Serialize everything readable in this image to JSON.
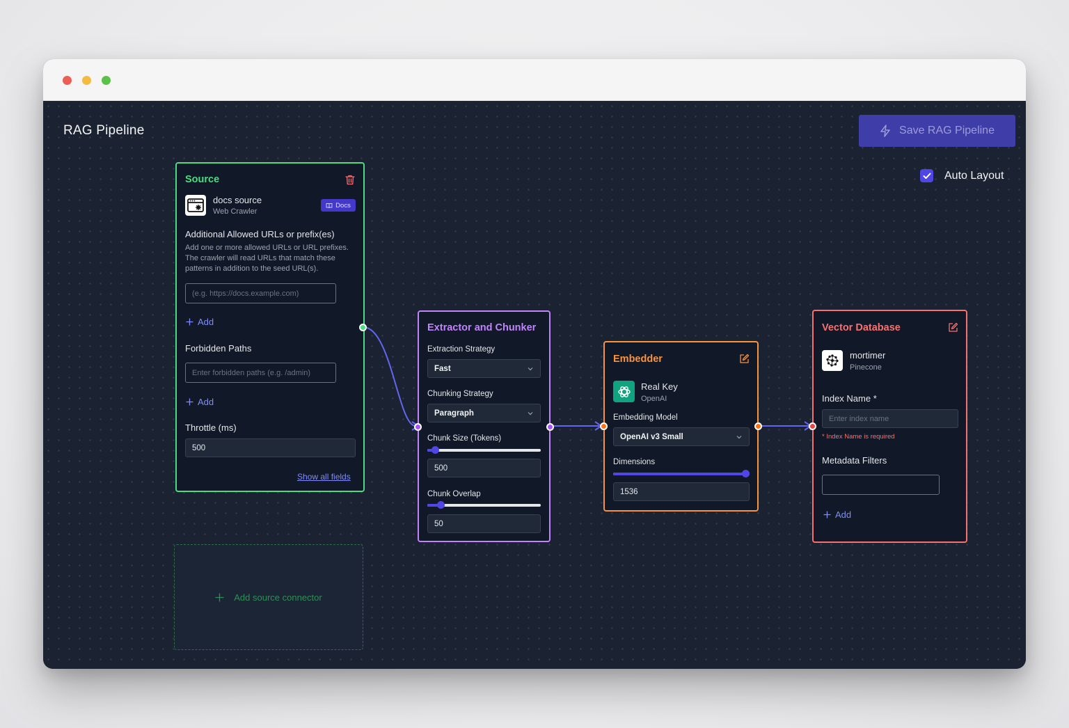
{
  "page": {
    "title": "RAG Pipeline"
  },
  "toolbar": {
    "save_label": "Save RAG Pipeline",
    "auto_layout_label": "Auto Layout",
    "auto_layout_checked": true
  },
  "colors": {
    "source": "#4ade80",
    "extractor": "#c084fc",
    "embedder": "#fb923c",
    "vector_db": "#f87171",
    "accent": "#4f46e5"
  },
  "source": {
    "title": "Source",
    "connector_name": "docs source",
    "connector_type": "Web Crawler",
    "docs_badge": "Docs",
    "allowed_urls_label": "Additional Allowed URLs or prefix(es)",
    "allowed_urls_help_1": "Add one or more allowed URLs or URL prefixes.",
    "allowed_urls_help_2": "The crawler will read URLs that match these",
    "allowed_urls_help_3": "patterns in addition to the seed URL(s).",
    "allowed_urls_placeholder": "(e.g. https://docs.example.com)",
    "add_label": "Add",
    "forbidden_label": "Forbidden Paths",
    "forbidden_placeholder": "Enter forbidden paths (e.g. /admin)",
    "throttle_label": "Throttle (ms)",
    "throttle_value": "500",
    "show_all": "Show all fields"
  },
  "add_source": {
    "label": "Add source connector"
  },
  "extractor": {
    "title": "Extractor and Chunker",
    "extraction_label": "Extraction Strategy",
    "extraction_value": "Fast",
    "chunking_label": "Chunking Strategy",
    "chunking_value": "Paragraph",
    "chunk_size_label": "Chunk Size (Tokens)",
    "chunk_size_value": "500",
    "chunk_size_fraction": 0.07,
    "overlap_label": "Chunk Overlap",
    "overlap_value": "50",
    "overlap_fraction": 0.12
  },
  "embedder": {
    "title": "Embedder",
    "key_name": "Real Key",
    "provider": "OpenAI",
    "model_label": "Embedding Model",
    "model_value": "OpenAI v3 Small",
    "dimensions_label": "Dimensions",
    "dimensions_value": "1536",
    "dimensions_fraction": 1.0
  },
  "vector_db": {
    "title": "Vector Database",
    "name": "mortimer",
    "provider": "Pinecone",
    "index_label": "Index Name *",
    "index_placeholder": "Enter index name",
    "index_error": "* Index Name is required",
    "metadata_label": "Metadata Filters",
    "add_label": "Add"
  },
  "icons": {
    "save": "bolt-icon",
    "check": "check-icon",
    "trash": "trash-icon",
    "edit": "edit-icon",
    "book": "book-icon",
    "plus": "plus-icon",
    "chevron": "chevron-down-icon",
    "crawler": "web-crawler-icon",
    "openai": "openai-logo",
    "pinecone": "pinecone-logo"
  }
}
